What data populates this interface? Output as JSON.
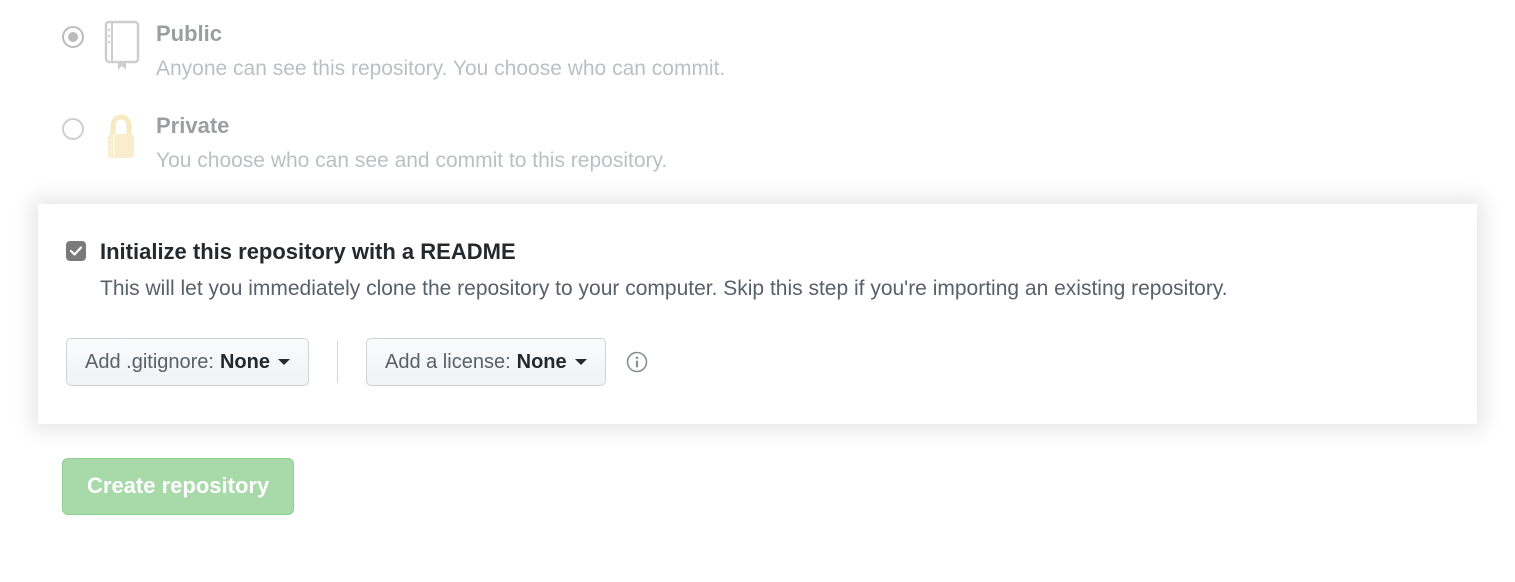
{
  "visibility": {
    "public": {
      "title": "Public",
      "desc": "Anyone can see this repository. You choose who can commit.",
      "selected": true
    },
    "private": {
      "title": "Private",
      "desc": "You choose who can see and commit to this repository.",
      "selected": false
    }
  },
  "initialize": {
    "checkbox_checked": true,
    "title": "Initialize this repository with a README",
    "desc": "This will let you immediately clone the repository to your computer. Skip this step if you're importing an existing repository."
  },
  "gitignore": {
    "label": "Add .gitignore:",
    "value": "None"
  },
  "license": {
    "label": "Add a license:",
    "value": "None"
  },
  "submit": {
    "label": "Create repository"
  }
}
